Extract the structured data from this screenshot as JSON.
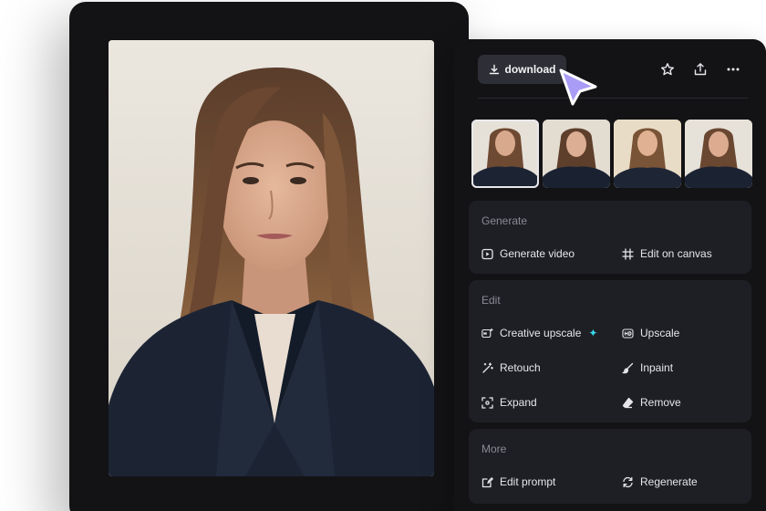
{
  "toolbar": {
    "download_label": "download"
  },
  "thumbnails": [
    {
      "selected": true
    },
    {
      "selected": false
    },
    {
      "selected": false
    },
    {
      "selected": false
    }
  ],
  "sections": {
    "generate": {
      "title": "Generate",
      "actions": [
        "Generate video",
        "Edit on canvas"
      ]
    },
    "edit": {
      "title": "Edit",
      "actions": [
        "Creative upscale",
        "Upscale",
        "Retouch",
        "Inpaint",
        "Expand",
        "Remove"
      ]
    },
    "more": {
      "title": "More",
      "actions": [
        "Edit prompt",
        "Regenerate"
      ]
    }
  },
  "icons": {
    "download": "download-icon",
    "star": "star-icon",
    "share": "share-icon",
    "more": "more-icon",
    "sparkle": "sparkle-icon"
  },
  "colors": {
    "panel_bg": "#131316",
    "section_bg": "#1e1f24",
    "button_bg": "#2e2f36",
    "accent_cursor": "#a99cf6",
    "sparkle": "#37d6e8"
  }
}
